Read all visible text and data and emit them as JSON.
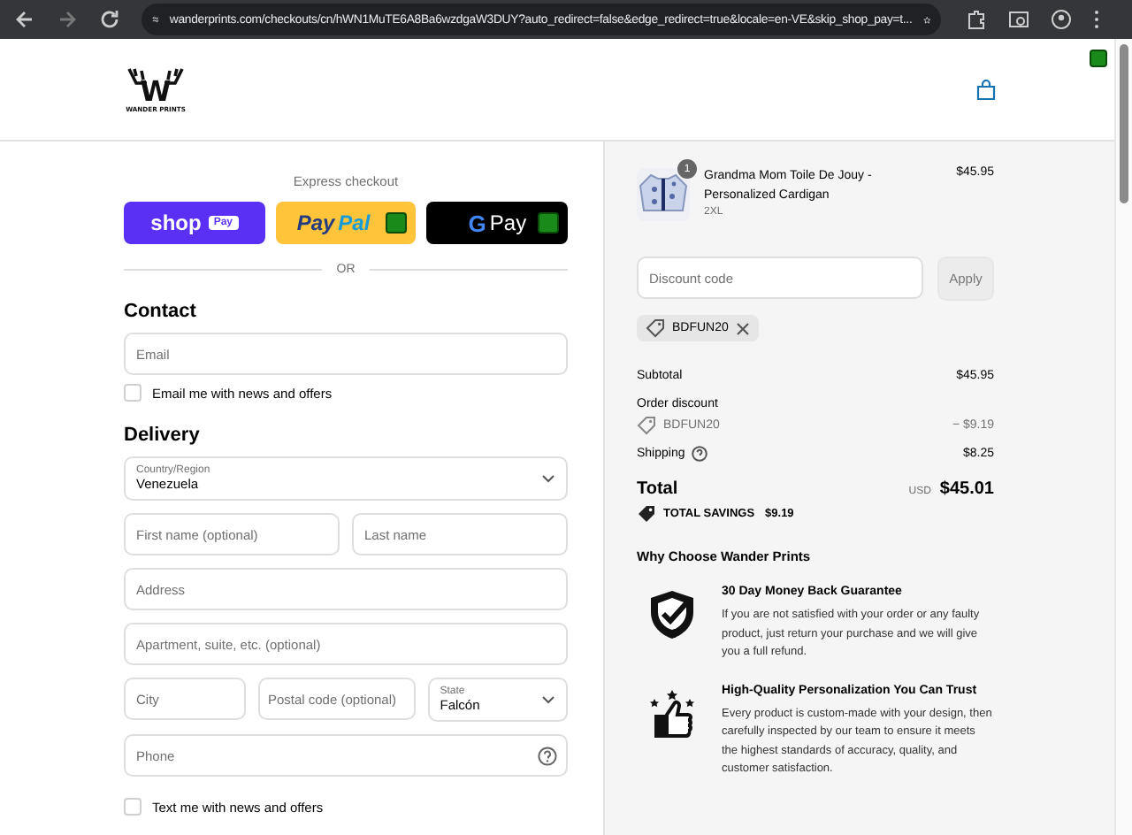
{
  "browser": {
    "url": "wanderprints.com/checkouts/cn/hWN1MuTE6A8Ba6wzdgaW3DUY?auto_redirect=false&edge_redirect=true&locale=en-VE&skip_shop_pay=t..."
  },
  "header": {
    "logo_text": "WANDER PRINTS",
    "logo_letter": "W"
  },
  "express": {
    "label": "Express checkout",
    "buttons": [
      {
        "kind": "shop_pay",
        "parts": [
          "shop",
          "Pay"
        ]
      },
      {
        "kind": "paypal",
        "parts": [
          "Pay",
          "Pal"
        ]
      },
      {
        "kind": "gpay",
        "parts": [
          "G",
          "Pay"
        ]
      }
    ],
    "divider": "OR"
  },
  "contact": {
    "heading": "Contact",
    "email": {
      "placeholder": "Email"
    },
    "newsletter": {
      "label": "Email me with news and offers",
      "checked": false
    }
  },
  "delivery": {
    "heading": "Delivery",
    "rows": [
      [
        {
          "kind": "select",
          "label": "Country/Region",
          "value": "Venezuela"
        }
      ],
      [
        {
          "kind": "text",
          "placeholder": "First name (optional)"
        },
        {
          "kind": "text",
          "placeholder": "Last name"
        }
      ],
      [
        {
          "kind": "text",
          "placeholder": "Address"
        }
      ],
      [
        {
          "kind": "text",
          "placeholder": "Apartment, suite, etc. (optional)"
        }
      ],
      [
        {
          "kind": "text",
          "placeholder": "City"
        },
        {
          "kind": "text",
          "placeholder": "Postal code (optional)"
        },
        {
          "kind": "select",
          "label": "State",
          "value": "Falcón"
        }
      ],
      [
        {
          "kind": "help",
          "placeholder": "Phone"
        }
      ]
    ],
    "sms": {
      "label": "Text me with news and offers",
      "checked": false
    }
  },
  "summary": {
    "items": [
      {
        "quantity": "1",
        "name": "Grandma Mom Toile De Jouy - Personalized Cardigan",
        "variant": "2XL",
        "price": "$45.95"
      }
    ],
    "discount": {
      "placeholder": "Discount code",
      "button": "Apply",
      "disabled": true
    },
    "applied_codes": [
      {
        "code": "BDFUN20"
      }
    ],
    "lines": [
      {
        "kind": "plain",
        "label": "Subtotal",
        "value": "$45.95"
      },
      {
        "kind": "heading",
        "label": "Order discount"
      },
      {
        "kind": "code",
        "label": "BDFUN20",
        "value": "− $9.19"
      },
      {
        "kind": "help",
        "label": "Shipping",
        "value": "$8.25"
      }
    ],
    "total": {
      "label": "Total",
      "currency": "USD",
      "amount": "$45.01"
    },
    "savings": {
      "label": "TOTAL SAVINGS",
      "amount": "$9.19"
    },
    "why": {
      "heading": "Why Choose Wander Prints",
      "features": [
        {
          "kind": "shield",
          "title": "30 Day Money Back Guarantee",
          "text": "If you are not satisfied with your order or any faulty product, just return your purchase and we will give you a full refund."
        },
        {
          "kind": "thumbs",
          "title": "High-Quality Personalization You Can Trust",
          "text": "Every product is custom-made with your design, then carefully inspected by our team to ensure it meets the highest standards of accuracy, quality, and customer satisfaction."
        }
      ]
    }
  }
}
